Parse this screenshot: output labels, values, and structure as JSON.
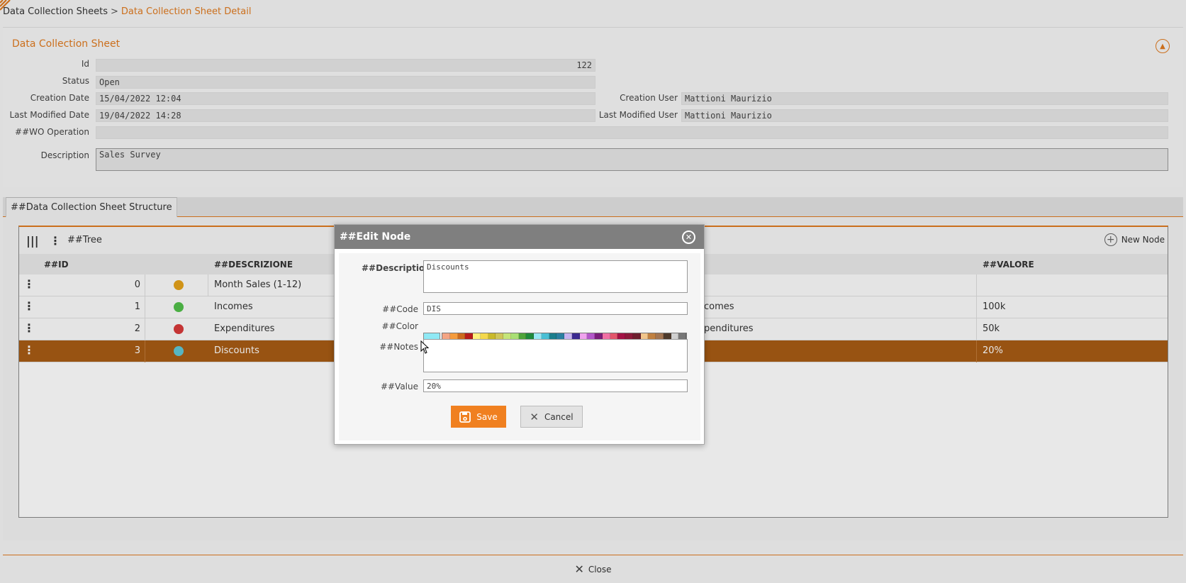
{
  "breadcrumb": {
    "parent": "Data Collection Sheets",
    "separator": ">",
    "current": "Data Collection Sheet Detail"
  },
  "sheet": {
    "title": "Data Collection Sheet",
    "fields": {
      "id": {
        "label": "Id",
        "value": "122"
      },
      "status": {
        "label": "Status",
        "value": "Open"
      },
      "creation_date": {
        "label": "Creation Date",
        "value": "15/04/2022 12:04"
      },
      "creation_user": {
        "label": "Creation User",
        "value": "Mattioni Maurizio"
      },
      "last_modified_date": {
        "label": "Last Modified Date",
        "value": "19/04/2022 14:28"
      },
      "last_modified_user": {
        "label": "Last Modified User",
        "value": "Mattioni Maurizio"
      },
      "wo_operation": {
        "label": "##WO Operation",
        "value": ""
      },
      "description": {
        "label": "Description",
        "value": "Sales Survey"
      }
    }
  },
  "structure": {
    "tab_label": "##Data Collection Sheet Structure",
    "toolbar": {
      "tree_label": "##Tree",
      "new_node_label": "New Node"
    },
    "columns": {
      "id": "##ID",
      "descrizione": "##DESCRIZIONE",
      "valore": "##VALORE"
    },
    "rows": [
      {
        "id": "0",
        "color": "#e5a21a",
        "description": "Month Sales (1-12)",
        "mid": "",
        "value": ""
      },
      {
        "id": "1",
        "color": "#52c04a",
        "description": "Incomes",
        "mid": "comes",
        "value": "100k"
      },
      {
        "id": "2",
        "color": "#d83a3a",
        "description": "Expenditures",
        "mid": "penditures",
        "value": "50k"
      },
      {
        "id": "3",
        "color": "#5fc7d6",
        "description": "Discounts",
        "mid": "",
        "value": "20%",
        "selected": true
      }
    ]
  },
  "modal": {
    "title": "##Edit Node",
    "labels": {
      "description": "##Description",
      "code": "##Code",
      "color": "##Color",
      "notes": "##Notes",
      "value": "##Value"
    },
    "values": {
      "description": "Discounts",
      "code": "DIS",
      "color": "#8fe9f5",
      "notes": "",
      "value": "20%"
    },
    "save_label": "Save",
    "cancel_label": "Cancel"
  },
  "palette_colors": [
    "#f4a483",
    "#f59b3b",
    "#cc6a1e",
    "#b71c1c",
    "#fff27d",
    "#f4d84c",
    "#c9b92a",
    "#cfc65a",
    "#c5e57a",
    "#a9df74",
    "#4fa43a",
    "#1f8a3c",
    "#9ae8f5",
    "#49bfd4",
    "#1b7e8c",
    "#2a7fa1",
    "#c7b3f0",
    "#3b2a8f",
    "#f0a3ee",
    "#b357c9",
    "#7a1d7a",
    "#f06fa3",
    "#e2566b",
    "#a31245",
    "#8b1a3a",
    "#6d1f2e",
    "#f1c58b",
    "#c08040",
    "#a27552",
    "#4d3a2c",
    "#d0d0d0",
    "#777777",
    "#f05858",
    "#f26c0e",
    "#8b2e0e",
    "#7a0f0f",
    "#ffe500",
    "#e6b800",
    "#8a7c10",
    "#8e8515",
    "#7bc61e",
    "#3bb430",
    "#1d6e26",
    "#0f5a2a",
    "#33d6e0",
    "#1aa3b5",
    "#0d5a66",
    "#1f5b79",
    "#7d5bd6",
    "#20175a",
    "#c619c9",
    "#7c1f9a",
    "#4a0f4a",
    "#ea1e7c",
    "#c01b47",
    "#7f0e34",
    "#5e0f26",
    "#461018",
    "#e5a55a",
    "#8c5a24",
    "#6e4a30",
    "#2b1e14",
    "#a8a8a8",
    "#3d3d3d"
  ],
  "footer": {
    "close_label": "Close"
  }
}
